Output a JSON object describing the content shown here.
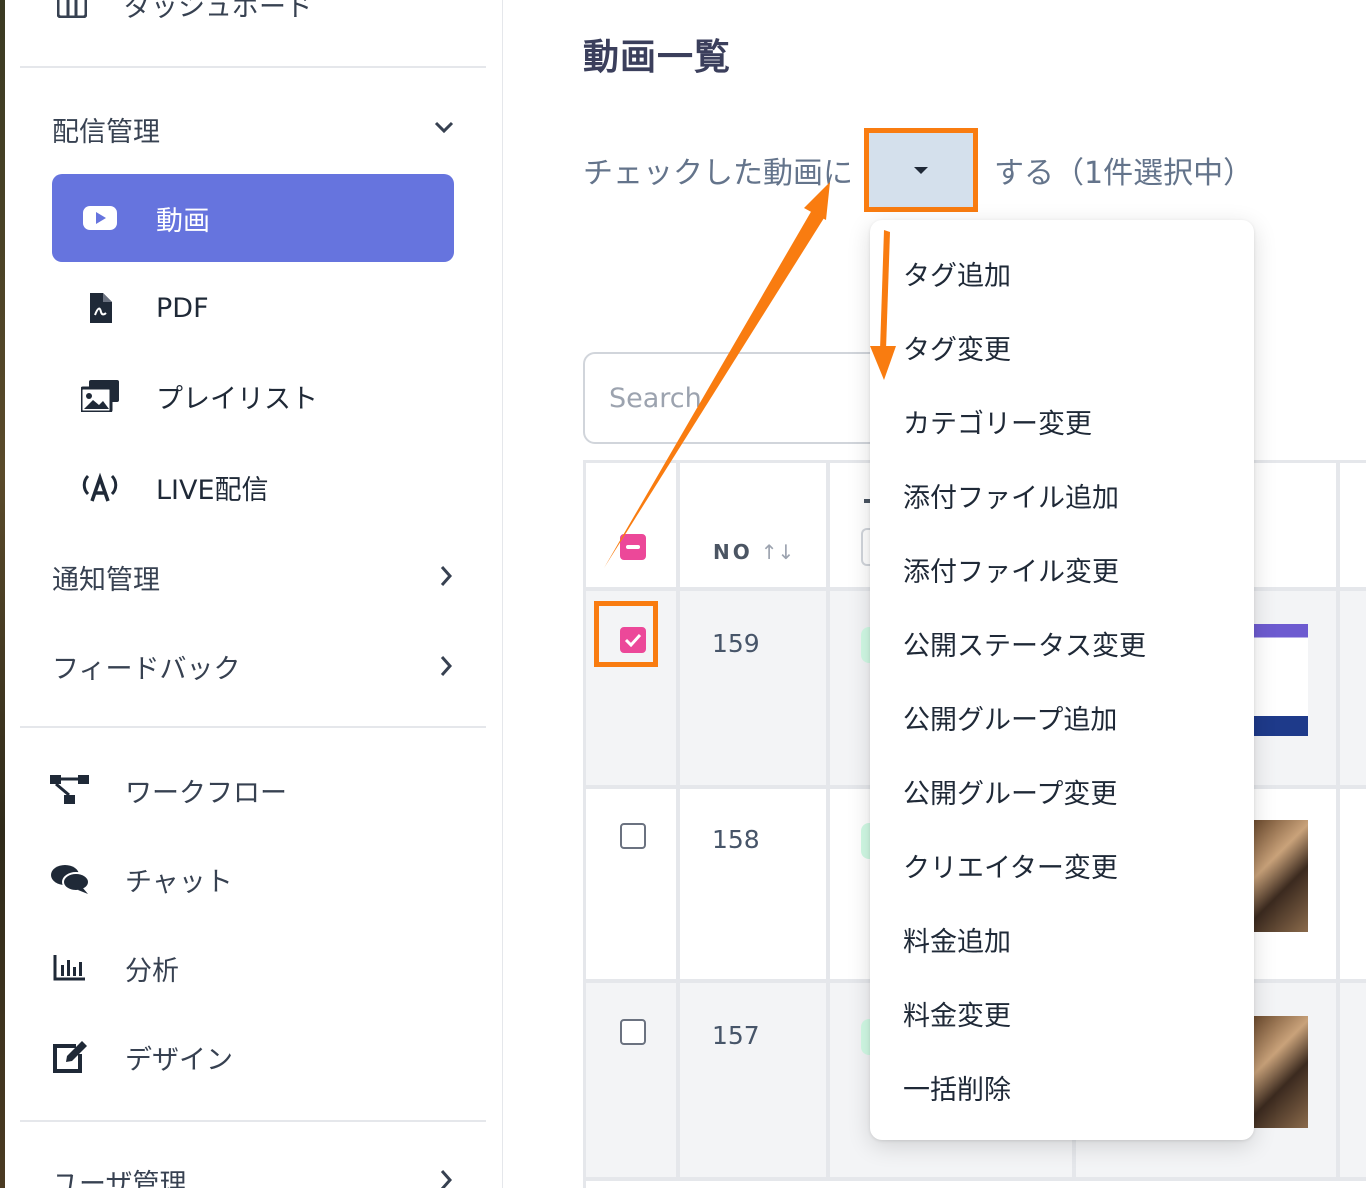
{
  "sidebar": {
    "dashboard_label": "ダッシュボード",
    "distribution": {
      "label": "配信管理",
      "items": [
        {
          "label": "動画",
          "icon": "youtube-icon"
        },
        {
          "label": "PDF",
          "icon": "pdf-file-icon"
        },
        {
          "label": "プレイリスト",
          "icon": "playlist-icon"
        },
        {
          "label": "LIVE配信",
          "icon": "broadcast-icon"
        }
      ]
    },
    "notifications_label": "通知管理",
    "feedback_label": "フィードバック",
    "tools": [
      {
        "label": "ワークフロー",
        "icon": "workflow-icon"
      },
      {
        "label": "チャット",
        "icon": "chat-icon"
      },
      {
        "label": "分析",
        "icon": "analytics-icon"
      },
      {
        "label": "デザイン",
        "icon": "edit-icon"
      }
    ],
    "users_label": "ユーザ管理"
  },
  "main": {
    "title": "動画一覧",
    "bulk_prefix": "チェックした動画に",
    "bulk_suffix": "する（1件選択中）",
    "search_placeholder": "Search",
    "table": {
      "no_header": "NO",
      "sort_glyph": "↑↓",
      "rows": [
        {
          "no": "159",
          "checked": true,
          "thumb": "slide"
        },
        {
          "no": "158",
          "checked": false,
          "thumb": "photo"
        },
        {
          "no": "157",
          "checked": false,
          "thumb": "photo"
        }
      ]
    }
  },
  "dropdown": {
    "items": [
      "タグ追加",
      "タグ変更",
      "カテゴリー変更",
      "添付ファイル追加",
      "添付ファイル変更",
      "公開ステータス変更",
      "公開グループ追加",
      "公開グループ変更",
      "クリエイター変更",
      "料金追加",
      "料金変更",
      "一括削除"
    ]
  },
  "colors": {
    "accent": "#6674de",
    "checkbox": "#ec4899",
    "annotation": "#f97c10"
  }
}
